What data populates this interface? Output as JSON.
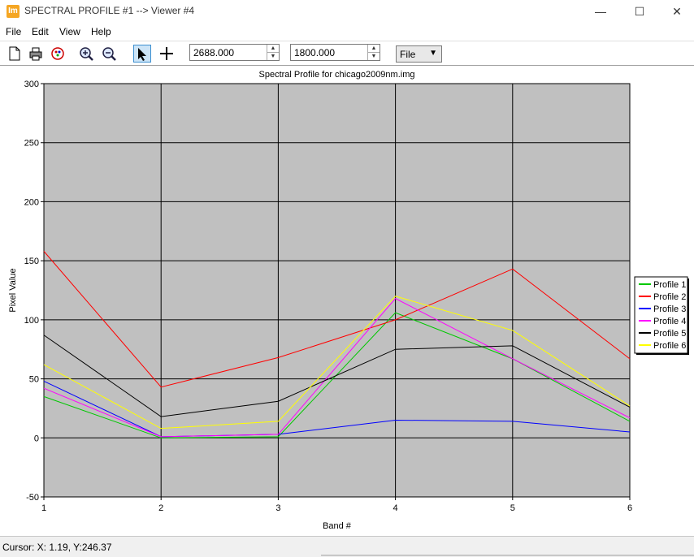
{
  "window": {
    "app_icon_text": "Im",
    "title": "SPECTRAL PROFILE #1 --> Viewer #4",
    "minimize": "—",
    "maximize": "☐",
    "close": "✕"
  },
  "menu": [
    "File",
    "Edit",
    "View",
    "Help"
  ],
  "toolbar": {
    "x_value": "2688.000",
    "y_value": "1800.000",
    "output_select": "File"
  },
  "chart_data": {
    "type": "line",
    "title": "Spectral Profile for chicago2009nm.img",
    "xlabel": "Band #",
    "ylabel": "Pixel Value",
    "x": [
      1,
      2,
      3,
      4,
      5,
      6
    ],
    "xlim": [
      1,
      6
    ],
    "ylim": [
      -50,
      300
    ],
    "yticks": [
      -50,
      0,
      50,
      100,
      150,
      200,
      250,
      300
    ],
    "grid": true,
    "background": "#c0c0c0",
    "legend_position": "right",
    "series": [
      {
        "name": "Profile 1",
        "color": "#00c800",
        "values": [
          35,
          0,
          1,
          106,
          67,
          14
        ]
      },
      {
        "name": "Profile 2",
        "color": "#ff0000",
        "values": [
          158,
          43,
          68,
          100,
          143,
          67
        ]
      },
      {
        "name": "Profile 3",
        "color": "#0000ff",
        "values": [
          48,
          1,
          3,
          15,
          14,
          5
        ]
      },
      {
        "name": "Profile 4",
        "color": "#ff00ff",
        "values": [
          42,
          1,
          3,
          118,
          67,
          17
        ]
      },
      {
        "name": "Profile 5",
        "color": "#000000",
        "values": [
          87,
          18,
          31,
          75,
          78,
          26
        ]
      },
      {
        "name": "Profile 6",
        "color": "#ffff00",
        "values": [
          62,
          8,
          14,
          120,
          91,
          27
        ]
      }
    ]
  },
  "status": {
    "cursor": "Cursor: X: 1.19, Y:246.37"
  }
}
